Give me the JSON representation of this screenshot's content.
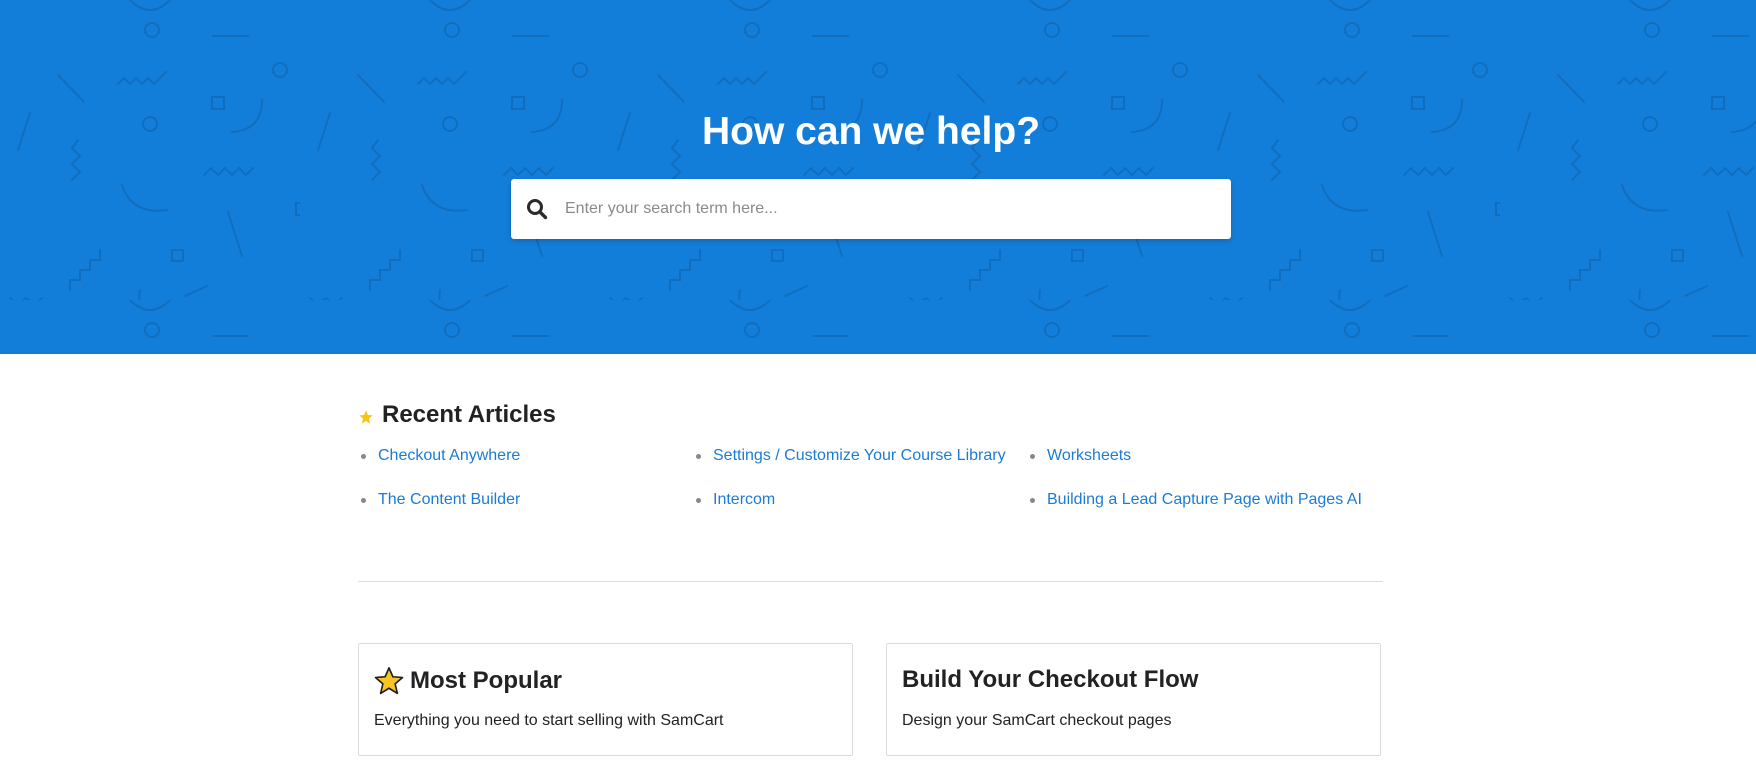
{
  "hero": {
    "title": "How can we help?",
    "background_color": "#137ed9",
    "search": {
      "placeholder": "Enter your search term here...",
      "value": "",
      "icon": "search-icon"
    }
  },
  "recent_articles": {
    "heading": "Recent Articles",
    "icon": "star-icon",
    "items": [
      {
        "label": "Checkout Anywhere"
      },
      {
        "label": "Settings / Customize Your Course Library"
      },
      {
        "label": "Worksheets"
      },
      {
        "label": "The Content Builder"
      },
      {
        "label": "Intercom"
      },
      {
        "label": "Building a Lead Capture Page with Pages AI"
      }
    ]
  },
  "categories": [
    {
      "title": "Most Popular",
      "icon": "star-emoji-icon",
      "description": "Everything you need to start selling with SamCart"
    },
    {
      "title": "Build Your Checkout Flow",
      "description": "Design your SamCart checkout pages"
    }
  ],
  "colors": {
    "link": "#1b7cd6",
    "star": "#f5c518",
    "hero_blue": "#137ed9"
  }
}
